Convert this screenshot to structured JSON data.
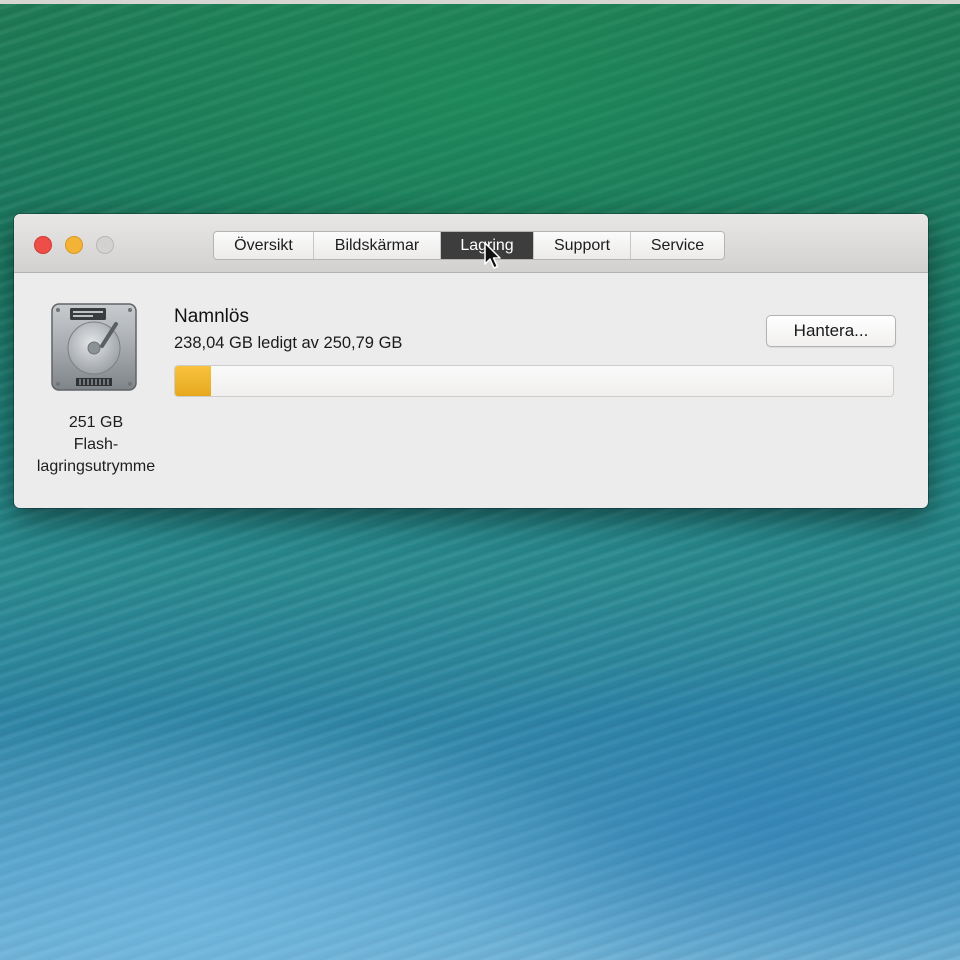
{
  "window": {
    "tabs": [
      {
        "label": "Översikt",
        "selected": false
      },
      {
        "label": "Bildskärmar",
        "selected": false
      },
      {
        "label": "Lagring",
        "selected": true
      },
      {
        "label": "Support",
        "selected": false
      },
      {
        "label": "Service",
        "selected": false
      }
    ]
  },
  "storage": {
    "disk": {
      "icon": "hard-drive-icon",
      "capacity": "251 GB",
      "type_line1": "Flash-",
      "type_line2": "lagringsutrymme"
    },
    "volume": {
      "name": "Namnlös",
      "free_text": "238,04 GB ledigt av 250,79 GB",
      "used_fraction": 0.0508
    },
    "manage_button": "Hantera..."
  },
  "colors": {
    "usage_fill": "#f0b530",
    "tab_selected": "#3e3d3d",
    "close": "#ee4e48",
    "minimize": "#f3b337"
  }
}
